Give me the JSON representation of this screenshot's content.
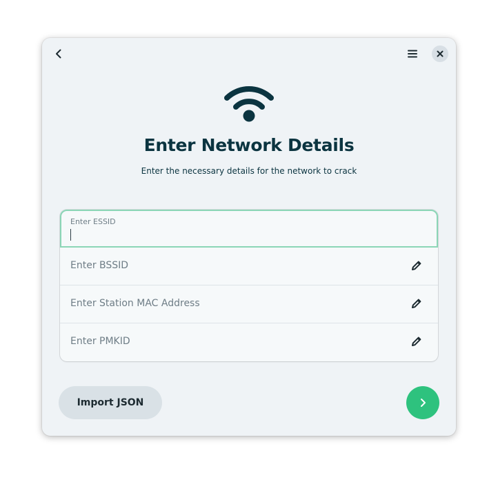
{
  "header": {
    "back_icon": "chevron-left-icon",
    "menu_icon": "hamburger-menu-icon",
    "close_icon": "close-icon"
  },
  "hero": {
    "icon": "wifi-icon",
    "title": "Enter Network Details",
    "subtitle": "Enter the necessary details for the network to crack"
  },
  "form": {
    "essid": {
      "label": "Enter ESSID",
      "value": ""
    },
    "bssid": {
      "placeholder": "Enter BSSID",
      "icon": "pencil-icon"
    },
    "station_mac": {
      "placeholder": "Enter Station MAC Address",
      "icon": "pencil-icon"
    },
    "pmkid": {
      "placeholder": "Enter PMKID",
      "icon": "pencil-icon"
    }
  },
  "actions": {
    "import_label": "Import JSON",
    "next_icon": "chevron-right-icon"
  },
  "colors": {
    "accent": "#2ec27e",
    "focus_border": "#8bd6b6",
    "title": "#0b3440",
    "window_bg": "#eff3f6"
  }
}
